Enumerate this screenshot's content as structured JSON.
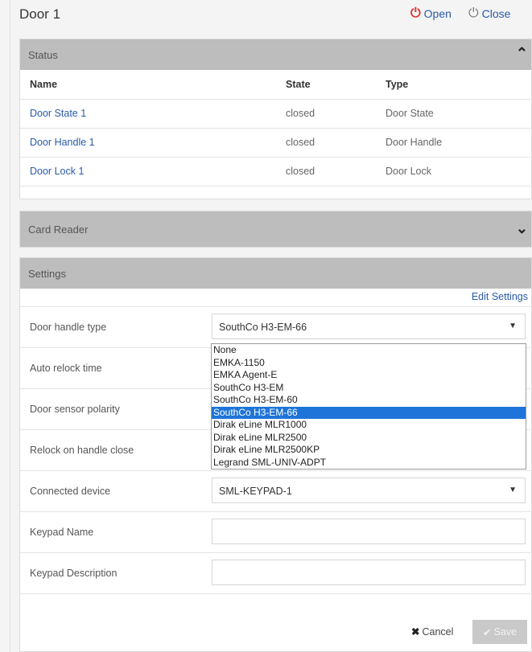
{
  "header": {
    "title": "Door 1",
    "open_label": "Open",
    "close_label": "Close"
  },
  "status": {
    "title": "Status",
    "columns": [
      "Name",
      "State",
      "Type"
    ],
    "rows": [
      {
        "name": "Door State 1",
        "state": "closed",
        "type": "Door State"
      },
      {
        "name": "Door Handle 1",
        "state": "closed",
        "type": "Door Handle"
      },
      {
        "name": "Door Lock 1",
        "state": "closed",
        "type": "Door Lock"
      }
    ]
  },
  "card_reader": {
    "title": "Card Reader"
  },
  "settings": {
    "title": "Settings",
    "edit_label": "Edit Settings",
    "fields": [
      {
        "label": "Door handle type",
        "value": "SouthCo H3-EM-66"
      },
      {
        "label": "Auto relock time",
        "value": ""
      },
      {
        "label": "Door sensor polarity",
        "value": ""
      },
      {
        "label": "Relock on handle close",
        "value": ""
      },
      {
        "label": "Connected device",
        "value": "SML-KEYPAD-1"
      },
      {
        "label": "Keypad Name",
        "value": ""
      },
      {
        "label": "Keypad Description",
        "value": ""
      }
    ],
    "dropdown_options": [
      "None",
      "EMKA-1150",
      "EMKA Agent-E",
      "SouthCo H3-EM",
      "SouthCo H3-EM-60",
      "SouthCo H3-EM-66",
      "Dirak eLine MLR1000",
      "Dirak eLine MLR2500",
      "Dirak eLine MLR2500KP",
      "Legrand SML-UNIV-ADPT"
    ],
    "selected_index": 5,
    "cancel_label": "Cancel",
    "save_label": "Save"
  }
}
